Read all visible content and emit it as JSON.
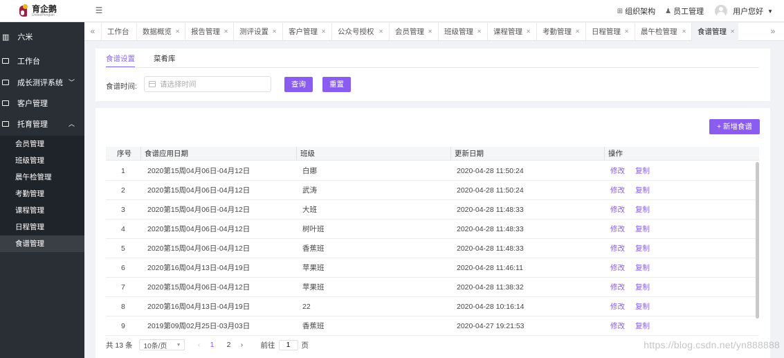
{
  "brand": {
    "name_cn": "育企鹅",
    "name_en": "UnitedPenguin"
  },
  "header": {
    "collapse_icon": "☰",
    "org_link": "组织架构",
    "staff_link": "员工管理",
    "user_greeting": "用户您好"
  },
  "sidebar": {
    "brand_label": "六米",
    "items": [
      {
        "label": "工作台"
      },
      {
        "label": "成长测评系统"
      },
      {
        "label": "客户管理"
      },
      {
        "label": "托育管理"
      }
    ],
    "subitems": [
      "会员管理",
      "班级管理",
      "晨午检管理",
      "考勤管理",
      "课程管理",
      "日程管理",
      "食谱管理"
    ]
  },
  "tabs": [
    "工作台",
    "数据概览",
    "报告管理",
    "测评设置",
    "客户管理",
    "公众号授权",
    "会员管理",
    "班级管理",
    "课程管理",
    "考勤管理",
    "日程管理",
    "晨午检管理",
    "食谱管理"
  ],
  "content": {
    "subtabs": [
      "食谱设置",
      "菜肴库"
    ],
    "search": {
      "label": "食谱时间:",
      "placeholder": "请选择时间",
      "query_button": "查询",
      "reset_button": "重置"
    },
    "add_button": "+ 新增食谱"
  },
  "table": {
    "columns": [
      "序号",
      "食谱应用日期",
      "班级",
      "更新日期",
      "操作"
    ],
    "action_edit": "修改",
    "action_copy": "复制",
    "rows": [
      {
        "no": "1",
        "date_range": "2020第15周04月06日-04月12日",
        "class": "白娜",
        "updated": "2020-04-28 11:50:24"
      },
      {
        "no": "2",
        "date_range": "2020第15周04月06日-04月12日",
        "class": "武涛",
        "updated": "2020-04-28 11:50:24"
      },
      {
        "no": "3",
        "date_range": "2020第15周04月06日-04月12日",
        "class": "大班",
        "updated": "2020-04-28 11:48:33"
      },
      {
        "no": "4",
        "date_range": "2020第15周04月06日-04月12日",
        "class": "树叶班",
        "updated": "2020-04-28 11:48:33"
      },
      {
        "no": "5",
        "date_range": "2020第15周04月06日-04月12日",
        "class": "香蕉班",
        "updated": "2020-04-28 11:48:33"
      },
      {
        "no": "6",
        "date_range": "2020第16周04月13日-04月19日",
        "class": "苹果班",
        "updated": "2020-04-28 11:46:11"
      },
      {
        "no": "7",
        "date_range": "2020第15周04月06日-04月12日",
        "class": "苹果班",
        "updated": "2020-04-28 11:38:32"
      },
      {
        "no": "8",
        "date_range": "2020第16周04月13日-04月19日",
        "class": "22",
        "updated": "2020-04-28 10:16:14"
      },
      {
        "no": "9",
        "date_range": "2019第09周02月25日-03月03日",
        "class": "香蕉班",
        "updated": "2020-04-27 19:21:53"
      }
    ]
  },
  "pagination": {
    "total": "共 13 条",
    "page_size": "10条/页",
    "pages": [
      "1",
      "2"
    ],
    "goto_label": "前往",
    "goto_value": "1",
    "page_suffix": "页"
  },
  "watermark": "https://blog.csdn.net/yn888888",
  "colors": {
    "accent": "#8a5cf0",
    "sidebar_bg": "#2a2f36",
    "brand_red": "#9c1f3f"
  }
}
